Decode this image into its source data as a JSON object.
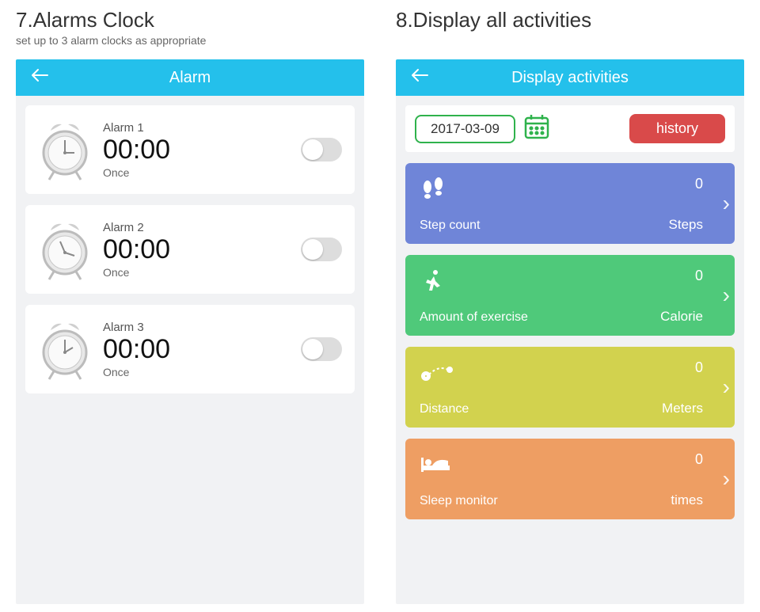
{
  "left": {
    "heading": "7.Alarms Clock",
    "subheading": "set up to 3 alarm clocks as appropriate",
    "topbar_title": "Alarm",
    "alarms": [
      {
        "name": "Alarm 1",
        "time": "00:00",
        "repeat": "Once"
      },
      {
        "name": "Alarm 2",
        "time": "00:00",
        "repeat": "Once"
      },
      {
        "name": "Alarm 3",
        "time": "00:00",
        "repeat": "Once"
      }
    ]
  },
  "right": {
    "heading": "8.Display all activities",
    "subheading": "",
    "topbar_title": "Display activities",
    "date": "2017-03-09",
    "history_label": "history",
    "cards": [
      {
        "label": "Step count",
        "value": "0",
        "unit": "Steps",
        "color": "c-blue"
      },
      {
        "label": "Amount of exercise",
        "value": "0",
        "unit": "Calorie",
        "color": "c-green"
      },
      {
        "label": "Distance",
        "value": "0",
        "unit": "Meters",
        "color": "c-yellow"
      },
      {
        "label": "Sleep monitor",
        "value": "0",
        "unit": "times",
        "color": "c-orange"
      }
    ]
  }
}
